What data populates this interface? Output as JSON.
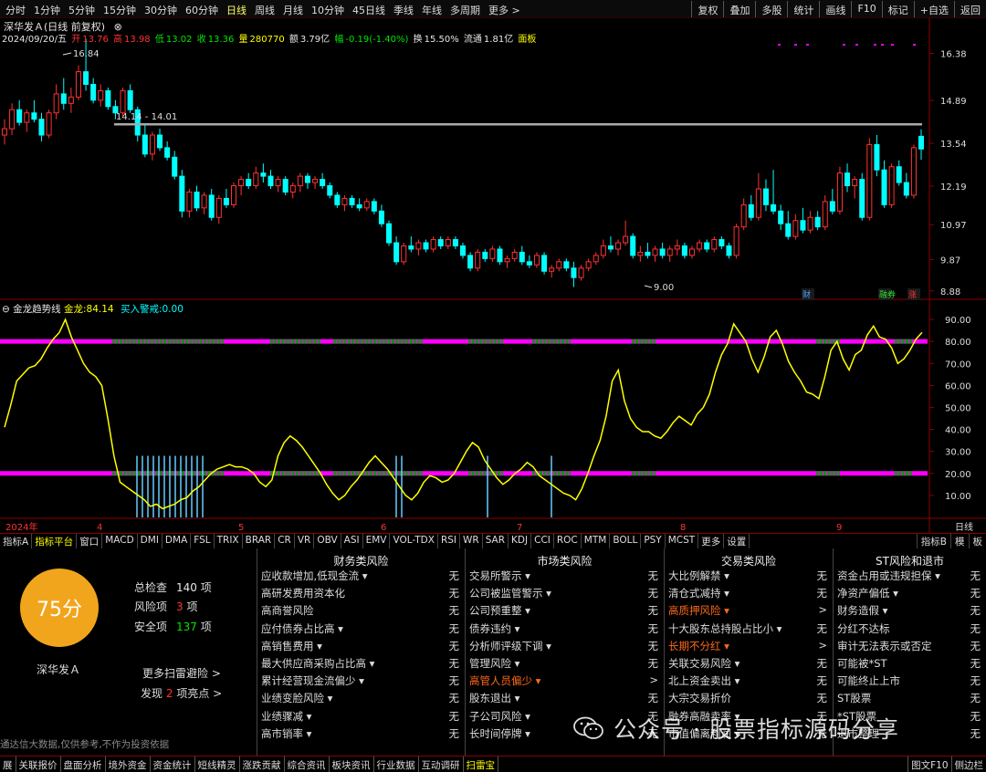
{
  "periods": [
    "分时",
    "1分钟",
    "5分钟",
    "15分钟",
    "30分钟",
    "60分钟",
    "日线",
    "周线",
    "月线",
    "10分钟",
    "45日线",
    "季线",
    "年线",
    "多周期",
    "更多 >"
  ],
  "active_period": "日线",
  "right_buttons": [
    "复权",
    "叠加",
    "多股",
    "统计",
    "画线",
    "F10",
    "标记",
    "+自选",
    "返回"
  ],
  "stock": {
    "name": "深华发Ａ",
    "mode": "(日线 前复权)"
  },
  "quote": {
    "date": "2024/09/20/五",
    "open_label": "开",
    "open": "13.76",
    "high_label": "高",
    "high": "13.98",
    "low_label": "低",
    "low": "13.02",
    "close_label": "收",
    "close": "13.36",
    "vol_label": "量",
    "vol": "280770",
    "amt_label": "额",
    "amt": "3.79亿",
    "chg_label": "幅",
    "chg": "-0.19(-1.40%)",
    "turn_label": "换",
    "turn": "15.50%",
    "float_label": "流通",
    "float": "1.81亿",
    "board": "面板"
  },
  "price_axis": [
    "16.38",
    "14.89",
    "13.54",
    "12.19",
    "10.97",
    "9.87",
    "8.88"
  ],
  "annotations": {
    "high": "16.84",
    "range": "14.14 - 14.01",
    "low": "9.00",
    "badge1": "财",
    "badge2": "融券",
    "badge3": "涨"
  },
  "indicator": {
    "name": "金龙趋势线",
    "series_label": "金龙:",
    "series_value": "84.14",
    "signal_label": "买入警戒:",
    "signal_value": "0.00"
  },
  "ind_axis": [
    "90.00",
    "80.00",
    "70.00",
    "60.00",
    "50.00",
    "40.00",
    "30.00",
    "20.00",
    "10.00"
  ],
  "date_axis": [
    "2024年",
    "4",
    "5",
    "6",
    "7",
    "8",
    "9"
  ],
  "date_axis_right": "日线",
  "tabs": [
    "指标A",
    "指标平台",
    "窗口",
    "MACD",
    "DMI",
    "DMA",
    "FSL",
    "TRIX",
    "BRAR",
    "CR",
    "VR",
    "OBV",
    "ASI",
    "EMV",
    "VOL-TDX",
    "RSI",
    "WR",
    "SAR",
    "KDJ",
    "CCI",
    "ROC",
    "MTM",
    "BOLL",
    "PSY",
    "MCST",
    "更多",
    "设置"
  ],
  "active_tab": "指标平台",
  "tabs_right": [
    "指标B",
    "模",
    "板"
  ],
  "scan": {
    "score": "75分",
    "stock_name": "深华发Ａ",
    "total_label": "总检查",
    "total": "140",
    "unit": "项",
    "risk_label": "风险项",
    "risk": "3",
    "safe_label": "安全项",
    "safe": "137",
    "more": "更多扫雷避险 >",
    "found_prefix": "发现",
    "found": "2",
    "found_suffix": "项亮点 >",
    "footnote": "通达信大数据,仅供参考,不作为投资依据"
  },
  "risk_columns": [
    {
      "title": "财务类风险",
      "items": [
        {
          "label": "应收款增加,低现金流 ▾",
          "value": "无"
        },
        {
          "label": "高研发费用资本化",
          "value": "无"
        },
        {
          "label": "高商誉风险",
          "value": "无"
        },
        {
          "label": "应付债券占比高 ▾",
          "value": "无"
        },
        {
          "label": "高销售费用 ▾",
          "value": "无"
        },
        {
          "label": "最大供应商采购占比高 ▾",
          "value": "无"
        },
        {
          "label": "累计经营现金流偏少 ▾",
          "value": "无"
        },
        {
          "label": "业绩变脸风险 ▾",
          "value": "无"
        },
        {
          "label": "业绩骤减 ▾",
          "value": "无"
        },
        {
          "label": "高市销率 ▾",
          "value": "无"
        }
      ]
    },
    {
      "title": "市场类风险",
      "items": [
        {
          "label": "交易所警示 ▾",
          "value": "无"
        },
        {
          "label": "公司被监管警示 ▾",
          "value": "无"
        },
        {
          "label": "公司预重整 ▾",
          "value": "无"
        },
        {
          "label": "债券违约 ▾",
          "value": "无"
        },
        {
          "label": "分析师评级下调 ▾",
          "value": "无"
        },
        {
          "label": "管理风险 ▾",
          "value": "无"
        },
        {
          "label": "高管人员偏少 ▾",
          "value": ">",
          "hl": true
        },
        {
          "label": "股东退出 ▾",
          "value": "无"
        },
        {
          "label": "子公司风险 ▾",
          "value": "无"
        },
        {
          "label": "长时间停牌 ▾",
          "value": "无"
        }
      ]
    },
    {
      "title": "交易类风险",
      "items": [
        {
          "label": "大比例解禁 ▾",
          "value": "无"
        },
        {
          "label": "清仓式减持 ▾",
          "value": "无"
        },
        {
          "label": "高质押风险 ▾",
          "value": ">",
          "hl": true
        },
        {
          "label": "十大股东总持股占比小 ▾",
          "value": "无"
        },
        {
          "label": "长期不分红 ▾",
          "value": ">",
          "hl": true
        },
        {
          "label": "关联交易风险 ▾",
          "value": "无"
        },
        {
          "label": "北上资金卖出 ▾",
          "value": "无"
        },
        {
          "label": "大宗交易折价",
          "value": "无"
        },
        {
          "label": "融券高融卖率 ▾",
          "value": "无"
        },
        {
          "label": "市值偏离利润 ▾",
          "value": "无"
        }
      ]
    },
    {
      "title": "ST风险和退市",
      "items": [
        {
          "label": "资金占用或违规担保 ▾",
          "value": "无"
        },
        {
          "label": "净资产偏低 ▾",
          "value": "无"
        },
        {
          "label": "财务造假 ▾",
          "value": "无"
        },
        {
          "label": "分红不达标",
          "value": "无"
        },
        {
          "label": "审计无法表示或否定",
          "value": "无"
        },
        {
          "label": "可能被*ST",
          "value": "无"
        },
        {
          "label": "可能终止上市",
          "value": "无"
        },
        {
          "label": "ST股票",
          "value": "无"
        },
        {
          "label": "*ST股票",
          "value": "无"
        },
        {
          "label": "退市整理",
          "value": "无"
        }
      ]
    }
  ],
  "bottom_tabs": [
    "展",
    "关联报价",
    "盘面分析",
    "境外资金",
    "资金统计",
    "短线精灵",
    "涨跌贡献",
    "综合资讯",
    "板块资讯",
    "行业数据",
    "互动调研",
    "扫雷宝"
  ],
  "active_bottom_tab": "扫雷宝",
  "bottom_right": [
    "图文F10",
    "侧边栏"
  ],
  "watermark": "公众号 · 股票指标源码分享",
  "colors": {
    "up": "#ff3232",
    "down": "#00ffff",
    "line": "#ffff00",
    "band": "#ff00ff",
    "score_bg": "#f1a51c"
  },
  "chart_data": {
    "type": "candlestick",
    "candles": [
      [
        13.8,
        14.3,
        13.5,
        14.0
      ],
      [
        14.0,
        14.8,
        13.8,
        14.6
      ],
      [
        14.6,
        14.9,
        14.1,
        14.2
      ],
      [
        14.2,
        14.6,
        13.9,
        14.5
      ],
      [
        14.5,
        14.9,
        14.2,
        14.3
      ],
      [
        14.3,
        14.5,
        13.6,
        13.8
      ],
      [
        13.8,
        14.6,
        13.7,
        14.5
      ],
      [
        14.5,
        15.4,
        14.3,
        15.1
      ],
      [
        15.1,
        15.6,
        14.6,
        14.8
      ],
      [
        14.8,
        15.3,
        14.5,
        15.0
      ],
      [
        15.0,
        16.0,
        14.9,
        15.8
      ],
      [
        15.8,
        16.84,
        15.2,
        15.4
      ],
      [
        15.4,
        15.6,
        14.8,
        14.9
      ],
      [
        14.9,
        15.4,
        14.7,
        15.2
      ],
      [
        15.2,
        15.3,
        14.6,
        14.7
      ],
      [
        14.7,
        14.9,
        14.3,
        14.5
      ],
      [
        14.5,
        15.3,
        14.4,
        15.2
      ],
      [
        15.2,
        15.4,
        14.5,
        14.6
      ],
      [
        14.6,
        14.7,
        13.6,
        13.8
      ],
      [
        13.8,
        14.14,
        13.1,
        13.2
      ],
      [
        13.2,
        13.9,
        13.0,
        13.8
      ],
      [
        13.8,
        14.0,
        13.3,
        13.4
      ],
      [
        13.4,
        13.6,
        13.0,
        13.1
      ],
      [
        13.1,
        13.3,
        12.4,
        12.5
      ],
      [
        12.5,
        12.7,
        11.2,
        11.4
      ],
      [
        11.4,
        12.1,
        11.2,
        12.0
      ],
      [
        12.0,
        12.2,
        11.4,
        11.5
      ],
      [
        11.5,
        12.0,
        11.3,
        11.9
      ],
      [
        11.9,
        12.1,
        11.1,
        11.2
      ],
      [
        11.2,
        11.9,
        11.0,
        11.8
      ],
      [
        11.8,
        12.1,
        11.5,
        11.6
      ],
      [
        11.6,
        12.3,
        11.5,
        12.2
      ],
      [
        12.2,
        12.5,
        11.9,
        12.4
      ],
      [
        12.4,
        12.6,
        12.1,
        12.2
      ],
      [
        12.2,
        12.8,
        12.1,
        12.6
      ],
      [
        12.6,
        12.9,
        12.3,
        12.5
      ],
      [
        12.5,
        12.7,
        12.1,
        12.2
      ],
      [
        12.2,
        12.5,
        12.0,
        12.4
      ],
      [
        12.4,
        12.5,
        11.9,
        12.0
      ],
      [
        12.0,
        12.3,
        11.8,
        12.2
      ],
      [
        12.2,
        12.6,
        12.0,
        12.5
      ],
      [
        12.5,
        12.6,
        12.1,
        12.3
      ],
      [
        12.3,
        12.5,
        12.1,
        12.4
      ],
      [
        12.4,
        12.6,
        12.1,
        12.2
      ],
      [
        12.2,
        12.3,
        11.8,
        11.9
      ],
      [
        11.9,
        12.0,
        11.5,
        11.6
      ],
      [
        11.6,
        11.9,
        11.4,
        11.8
      ],
      [
        11.8,
        11.9,
        11.5,
        11.6
      ],
      [
        11.6,
        11.8,
        11.4,
        11.5
      ],
      [
        11.5,
        11.8,
        11.4,
        11.7
      ],
      [
        11.7,
        11.8,
        11.3,
        11.4
      ],
      [
        11.4,
        11.6,
        10.9,
        11.0
      ],
      [
        11.0,
        11.1,
        10.3,
        10.4
      ],
      [
        10.4,
        10.6,
        9.7,
        9.8
      ],
      [
        9.8,
        10.4,
        9.7,
        10.3
      ],
      [
        10.3,
        10.6,
        10.1,
        10.2
      ],
      [
        10.2,
        10.5,
        10.0,
        10.4
      ],
      [
        10.4,
        10.5,
        10.1,
        10.2
      ],
      [
        10.2,
        10.6,
        10.1,
        10.5
      ],
      [
        10.5,
        10.6,
        10.2,
        10.3
      ],
      [
        10.3,
        10.6,
        10.2,
        10.5
      ],
      [
        10.5,
        10.6,
        10.2,
        10.3
      ],
      [
        10.3,
        10.4,
        9.9,
        10.0
      ],
      [
        10.0,
        10.1,
        9.5,
        9.6
      ],
      [
        9.6,
        10.2,
        9.5,
        10.1
      ],
      [
        10.1,
        10.2,
        9.8,
        9.9
      ],
      [
        9.9,
        10.3,
        9.8,
        10.2
      ],
      [
        10.2,
        10.3,
        9.7,
        9.8
      ],
      [
        9.8,
        10.0,
        9.6,
        9.9
      ],
      [
        9.9,
        10.2,
        9.8,
        10.1
      ],
      [
        10.1,
        10.3,
        9.7,
        9.8
      ],
      [
        9.8,
        10.0,
        9.6,
        9.7
      ],
      [
        9.7,
        10.1,
        9.6,
        10.0
      ],
      [
        10.0,
        10.1,
        9.4,
        9.5
      ],
      [
        9.5,
        9.7,
        9.3,
        9.6
      ],
      [
        9.6,
        9.9,
        9.5,
        9.8
      ],
      [
        9.8,
        9.9,
        9.5,
        9.6
      ],
      [
        9.6,
        9.8,
        9.0,
        9.3
      ],
      [
        9.3,
        9.7,
        9.2,
        9.6
      ],
      [
        9.6,
        9.9,
        9.5,
        9.8
      ],
      [
        9.8,
        10.1,
        9.7,
        10.0
      ],
      [
        10.0,
        10.5,
        9.9,
        10.3
      ],
      [
        10.3,
        10.6,
        10.1,
        10.2
      ],
      [
        10.2,
        10.5,
        10.0,
        10.4
      ],
      [
        10.4,
        11.1,
        10.3,
        10.6
      ],
      [
        10.6,
        10.7,
        9.9,
        10.0
      ],
      [
        10.0,
        10.3,
        9.8,
        10.1
      ],
      [
        10.1,
        10.4,
        9.9,
        10.0
      ],
      [
        10.0,
        10.3,
        9.8,
        10.2
      ],
      [
        10.2,
        10.4,
        9.9,
        10.0
      ],
      [
        10.0,
        10.3,
        9.8,
        10.2
      ],
      [
        10.2,
        10.5,
        10.0,
        10.3
      ],
      [
        10.3,
        10.4,
        9.9,
        10.0
      ],
      [
        10.0,
        10.3,
        9.9,
        10.2
      ],
      [
        10.2,
        10.5,
        10.1,
        10.4
      ],
      [
        10.4,
        10.5,
        10.1,
        10.2
      ],
      [
        10.2,
        10.6,
        10.1,
        10.5
      ],
      [
        10.5,
        10.6,
        10.2,
        10.3
      ],
      [
        10.3,
        10.4,
        9.9,
        10.0
      ],
      [
        10.0,
        11.0,
        9.9,
        10.9
      ],
      [
        10.9,
        11.8,
        10.8,
        11.6
      ],
      [
        11.6,
        11.9,
        11.1,
        11.2
      ],
      [
        11.2,
        12.6,
        11.1,
        12.1
      ],
      [
        12.1,
        12.4,
        11.4,
        11.6
      ],
      [
        11.6,
        12.7,
        11.3,
        11.4
      ],
      [
        11.4,
        11.6,
        10.8,
        11.0
      ],
      [
        11.0,
        11.4,
        10.5,
        10.6
      ],
      [
        10.6,
        11.3,
        10.5,
        11.1
      ],
      [
        11.1,
        11.5,
        10.7,
        10.8
      ],
      [
        10.8,
        11.4,
        10.7,
        11.2
      ],
      [
        11.2,
        11.4,
        10.8,
        10.9
      ],
      [
        10.9,
        11.9,
        10.8,
        11.7
      ],
      [
        11.7,
        12.1,
        11.3,
        11.4
      ],
      [
        11.4,
        12.8,
        11.3,
        12.6
      ],
      [
        12.6,
        12.9,
        12.0,
        12.2
      ],
      [
        12.2,
        12.5,
        11.8,
        12.4
      ],
      [
        12.4,
        12.6,
        11.1,
        11.2
      ],
      [
        11.2,
        13.7,
        11.1,
        13.5
      ],
      [
        13.5,
        13.8,
        12.5,
        12.7
      ],
      [
        12.7,
        13.0,
        11.5,
        11.6
      ],
      [
        11.6,
        12.9,
        11.5,
        12.8
      ],
      [
        12.8,
        13.0,
        12.2,
        12.3
      ],
      [
        12.3,
        12.6,
        11.8,
        11.9
      ],
      [
        11.9,
        13.5,
        11.8,
        13.4
      ],
      [
        13.76,
        13.98,
        13.02,
        13.36
      ]
    ],
    "indicator_line": [
      41,
      51,
      62,
      65,
      68,
      69,
      72,
      77,
      81,
      84,
      90,
      82,
      76,
      70,
      66,
      64,
      60,
      45,
      28,
      16,
      14,
      12,
      10,
      8,
      5,
      6,
      4,
      5,
      6,
      8,
      9,
      12,
      14,
      17,
      20,
      22,
      23,
      24,
      23,
      23,
      22,
      20,
      16,
      14,
      17,
      28,
      34,
      37,
      35,
      32,
      28,
      24,
      20,
      15,
      11,
      8,
      10,
      14,
      17,
      21,
      25,
      28,
      25,
      22,
      18,
      14,
      10,
      8,
      11,
      16,
      19,
      18,
      16,
      17,
      20,
      25,
      30,
      34,
      32,
      26,
      22,
      18,
      15,
      17,
      20,
      22,
      25,
      23,
      19,
      17,
      15,
      13,
      11,
      10,
      8,
      13,
      20,
      28,
      35,
      46,
      62,
      67,
      53,
      45,
      41,
      39,
      39,
      37,
      36,
      39,
      43,
      46,
      44,
      42,
      47,
      50,
      56,
      66,
      74,
      79,
      88,
      84,
      80,
      72,
      66,
      73,
      82,
      85,
      79,
      71,
      66,
      62,
      57,
      56,
      54,
      64,
      76,
      80,
      72,
      67,
      74,
      76,
      83,
      87,
      82,
      81,
      77,
      70,
      72,
      76,
      81,
      84.14
    ],
    "bands": [
      80,
      20
    ],
    "ind_ylim": [
      0,
      95
    ],
    "ylim": [
      8.7,
      17.2
    ]
  }
}
